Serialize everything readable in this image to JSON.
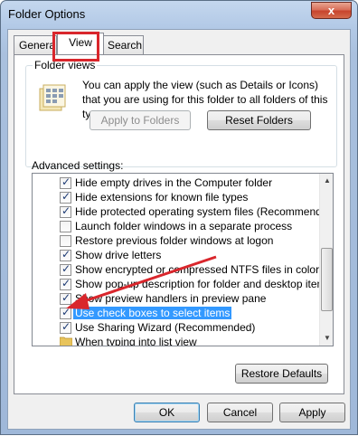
{
  "window": {
    "title": "Folder Options",
    "close_label": "x"
  },
  "tabs": [
    {
      "label": "General",
      "visible": "Genera"
    },
    {
      "label": "View"
    },
    {
      "label": "Search"
    }
  ],
  "folder_views": {
    "label": "Folder views",
    "description": "You can apply the view (such as Details or Icons) that you are using for this folder to all folders of this type.",
    "apply_button": "Apply to Folders",
    "reset_button": "Reset Folders"
  },
  "advanced": {
    "label": "Advanced settings:",
    "items": [
      {
        "text": "Hide empty drives in the Computer folder",
        "checked": true
      },
      {
        "text": "Hide extensions for known file types",
        "checked": true
      },
      {
        "text": "Hide protected operating system files (Recommended)",
        "checked": true
      },
      {
        "text": "Launch folder windows in a separate process",
        "checked": false
      },
      {
        "text": "Restore previous folder windows at logon",
        "checked": false
      },
      {
        "text": "Show drive letters",
        "checked": true
      },
      {
        "text": "Show encrypted or compressed NTFS files in color",
        "checked": true
      },
      {
        "text": "Show pop-up description for folder and desktop items",
        "checked": true
      },
      {
        "text": "Show preview handlers in preview pane",
        "checked": true
      },
      {
        "text": "Use check boxes to select items",
        "checked": true,
        "selected": true
      },
      {
        "text": "Use Sharing Wizard (Recommended)",
        "checked": true
      },
      {
        "text": "When typing into list view",
        "folder": true
      }
    ]
  },
  "buttons": {
    "restore_defaults": "Restore Defaults",
    "ok": "OK",
    "cancel": "Cancel",
    "apply": "Apply"
  },
  "colors": {
    "highlight_red": "#d9262c",
    "selection_blue": "#3399ff"
  }
}
